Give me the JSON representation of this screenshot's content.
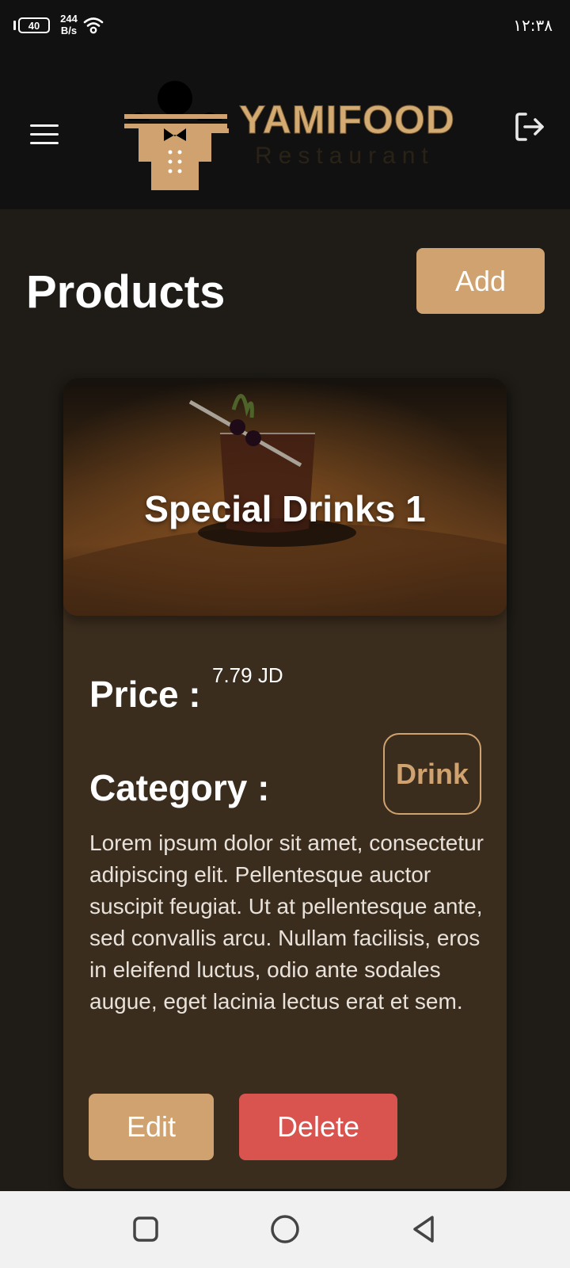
{
  "status_bar": {
    "battery_level": "40",
    "net_speed_value": "244",
    "net_speed_unit": "B/s",
    "time": "١٢:٣٨"
  },
  "header": {
    "logo_title": "YAMIFOOD",
    "logo_subtitle": "Restaurant",
    "menu_icon": "hamburger-menu-icon",
    "logout_icon": "logout-icon"
  },
  "page": {
    "title": "Products",
    "add_label": "Add"
  },
  "product": {
    "name": "Special Drinks 1",
    "price_label": "Price :",
    "price_value": "7.79 JD",
    "category_label": "Category :",
    "category_value": "Drink",
    "description": "Lorem ipsum dolor sit amet, consectetur adipiscing elit. Pellentesque auctor suscipit feugiat. Ut at pellentesque ante, sed convallis arcu. Nullam facilisis, eros in eleifend luctus, odio ante sodales augue, eget lacinia lectus erat et sem.",
    "edit_label": "Edit",
    "delete_label": "Delete"
  },
  "nav_bar": {
    "recents_icon": "square-icon",
    "home_icon": "circle-icon",
    "back_icon": "triangle-back-icon"
  },
  "colors": {
    "accent": "#cfa26f",
    "danger": "#d9534f",
    "card_background": "#3b2d1e",
    "page_background": "#1f1c17",
    "header_background": "#111111"
  }
}
